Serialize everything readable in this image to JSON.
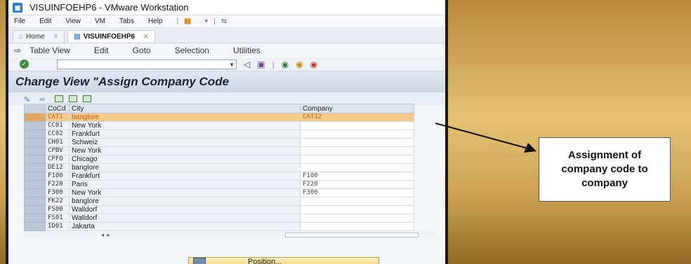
{
  "window": {
    "title": "VISUINFOEHP6 - VMware Workstation",
    "menu": [
      "File",
      "Edit",
      "View",
      "VM",
      "Tabs",
      "Help"
    ]
  },
  "tabs": [
    {
      "label": "Home",
      "active": false
    },
    {
      "label": "VISUINFOEHP6",
      "active": true
    }
  ],
  "sap_menu": [
    "Table View",
    "Edit",
    "Goto",
    "Selection",
    "Utilities"
  ],
  "page_title": "Change View \"Assign Company Code",
  "grid": {
    "headers": {
      "code": "CoCd",
      "city": "City",
      "company": "Company"
    },
    "rows": [
      {
        "code": "CAT1",
        "city": "banglore",
        "company": "CAT12",
        "highlight": true
      },
      {
        "code": "CC01",
        "city": "New York",
        "company": ""
      },
      {
        "code": "CC02",
        "city": "Frankfurt",
        "company": ""
      },
      {
        "code": "CH01",
        "city": "Schweiz",
        "company": ""
      },
      {
        "code": "CPBV",
        "city": "New York",
        "company": ""
      },
      {
        "code": "CPFO",
        "city": "Chicago",
        "company": ""
      },
      {
        "code": "DE12",
        "city": "banglore",
        "company": ""
      },
      {
        "code": "F100",
        "city": "Frankfurt",
        "company": "F100"
      },
      {
        "code": "F220",
        "city": "Paris",
        "company": "F220"
      },
      {
        "code": "F300",
        "city": "New York",
        "company": "F300"
      },
      {
        "code": "FK22",
        "city": "banglore",
        "company": ""
      },
      {
        "code": "FS00",
        "city": "Walldorf",
        "company": ""
      },
      {
        "code": "FS01",
        "city": "Walldorf",
        "company": ""
      },
      {
        "code": "ID01",
        "city": "Jakarta",
        "company": ""
      }
    ]
  },
  "position_button": "Position...",
  "callout": "Assignment of company code to company",
  "colors": {
    "highlight_row": "#f7c98a",
    "highlight_text": "#c85a10",
    "accent": "#2d7fd3"
  }
}
